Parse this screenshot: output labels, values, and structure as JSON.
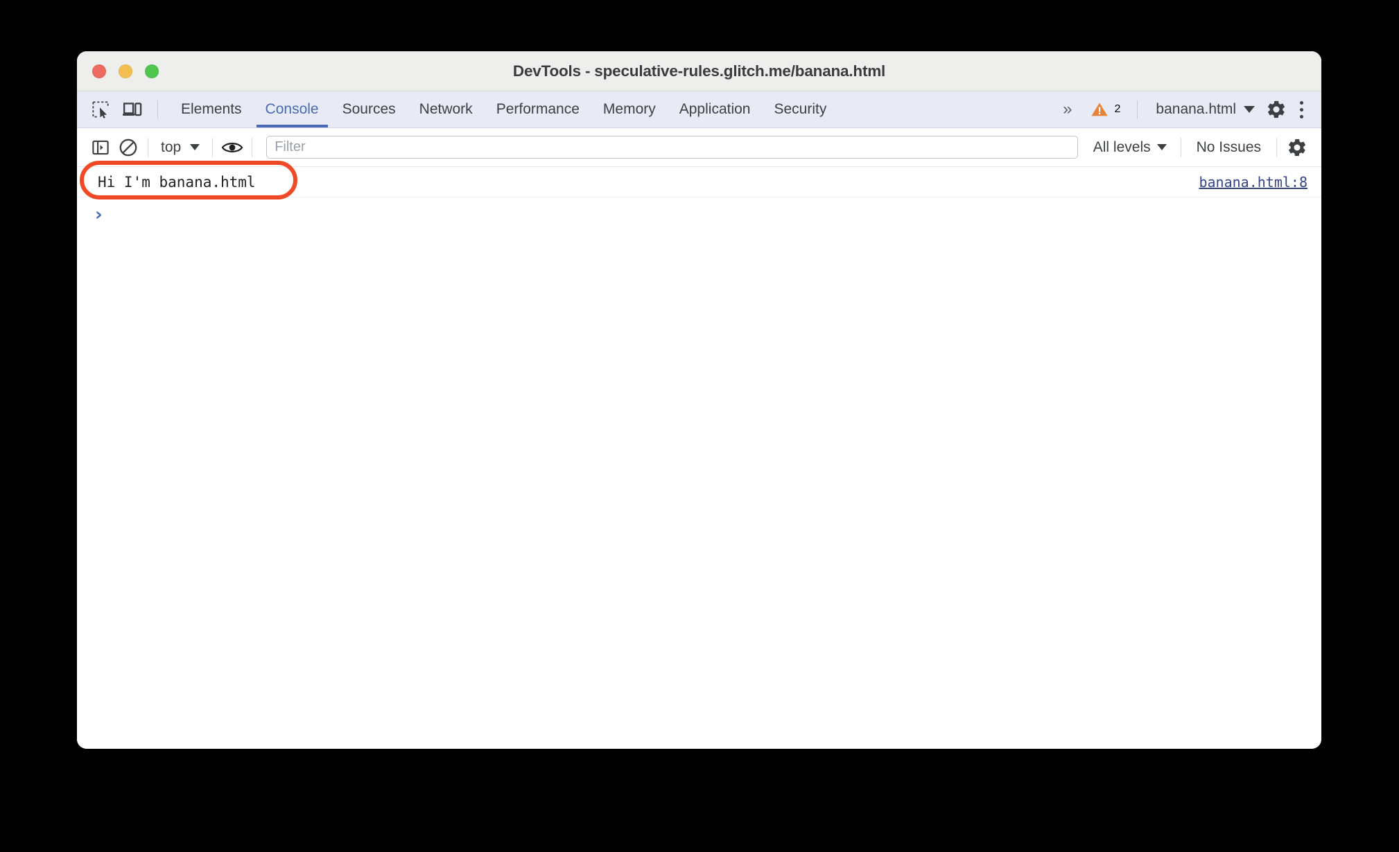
{
  "window": {
    "title": "DevTools - speculative-rules.glitch.me/banana.html",
    "traffic_lights": [
      {
        "name": "close",
        "color": "#ec6a5f"
      },
      {
        "name": "minimize",
        "color": "#f1be4f"
      },
      {
        "name": "zoom",
        "color": "#4fc54e"
      }
    ]
  },
  "tabbar": {
    "inspect_icon": "inspect-element-icon",
    "device_icon": "device-toolbar-icon",
    "tabs": [
      {
        "label": "Elements",
        "active": false
      },
      {
        "label": "Console",
        "active": true
      },
      {
        "label": "Sources",
        "active": false
      },
      {
        "label": "Network",
        "active": false
      },
      {
        "label": "Performance",
        "active": false
      },
      {
        "label": "Memory",
        "active": false
      },
      {
        "label": "Application",
        "active": false
      },
      {
        "label": "Security",
        "active": false
      }
    ],
    "more_tabs_label": "»",
    "warning_icon": "warning-triangle-icon",
    "warning_count": "2",
    "warning_color": "#e8833a",
    "context_label": "banana.html",
    "settings_icon": "gear-icon",
    "menu_icon": "kebab-menu-icon"
  },
  "console_toolbar": {
    "sidebar_icon": "console-sidebar-icon",
    "clear_icon": "clear-console-icon",
    "context_label": "top",
    "eye_icon": "live-expression-eye-icon",
    "filter_placeholder": "Filter",
    "filter_value": "",
    "levels_label": "All levels",
    "issues_label": "No Issues",
    "settings_icon": "console-settings-gear-icon"
  },
  "console": {
    "messages": [
      {
        "text": "Hi I'm banana.html",
        "source": "banana.html:8",
        "annotated": true
      }
    ],
    "prompt_chevron": "›",
    "prompt_value": ""
  },
  "annotation": {
    "color": "#ef4a25",
    "shape": "ellipse-highlight"
  }
}
